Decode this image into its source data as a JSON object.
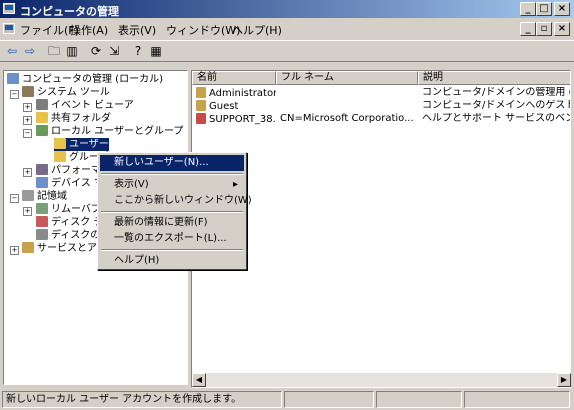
{
  "window": {
    "title": "コンピュータの管理"
  },
  "menubar": [
    "ファイル(F)",
    "操作(A)",
    "表示(V)",
    "ウィンドウ(W)",
    "ヘルプ(H)"
  ],
  "tree": [
    {
      "label": "コンピュータの管理 (ローカル)",
      "icon": "computer-icon"
    },
    {
      "label": "システム ツール",
      "icon": "tools-icon"
    },
    {
      "label": "イベント ビューア",
      "icon": "event-viewer-icon"
    },
    {
      "label": "共有フォルダ",
      "icon": "shared-folder-icon"
    },
    {
      "label": "ローカル ユーザーとグループ",
      "icon": "users-groups-icon"
    },
    {
      "label": "ユーザー",
      "icon": "folder-icon"
    },
    {
      "label": "グループ",
      "icon": "folder-icon"
    },
    {
      "label": "パフォーマンス ログと警告",
      "icon": "performance-icon"
    },
    {
      "label": "デバイス マネージャ",
      "icon": "device-manager-icon"
    },
    {
      "label": "記憶域",
      "icon": "storage-icon"
    },
    {
      "label": "リムーバブル記憶域",
      "icon": "removable-storage-icon"
    },
    {
      "label": "ディスク デフラグ",
      "icon": "defrag-icon"
    },
    {
      "label": "ディスクの管理",
      "icon": "disk-management-icon"
    },
    {
      "label": "サービスとアプリケーション",
      "icon": "services-icon"
    }
  ],
  "list": {
    "columns": [
      "名前",
      "フル ネーム",
      "説明"
    ],
    "rows": [
      [
        "Administrator",
        "",
        "コンピュータ/ドメインの管理用 (ビル"
      ],
      [
        "Guest",
        "",
        "コンピュータ/ドメインへのゲスト アクセ"
      ],
      [
        "SUPPORT_38...",
        "CN=Microsoft Corporatio...",
        "ヘルプとサポート サービスのベンダ ア"
      ]
    ]
  },
  "context_menu": {
    "new_user": "新しいユーザー(N)...",
    "view": "表示(V)",
    "new_window": "ここから新しいウィンドウ(W)",
    "refresh": "最新の情報に更新(F)",
    "export": "一覧のエクスポート(L)...",
    "help": "ヘルプ(H)"
  },
  "status": {
    "text": "新しいローカル ユーザー アカウントを作成します。"
  },
  "colors": {
    "title_start": "#0a246a",
    "title_end": "#a6caf0",
    "selection": "#0a246a",
    "face": "#d4d0c8"
  }
}
